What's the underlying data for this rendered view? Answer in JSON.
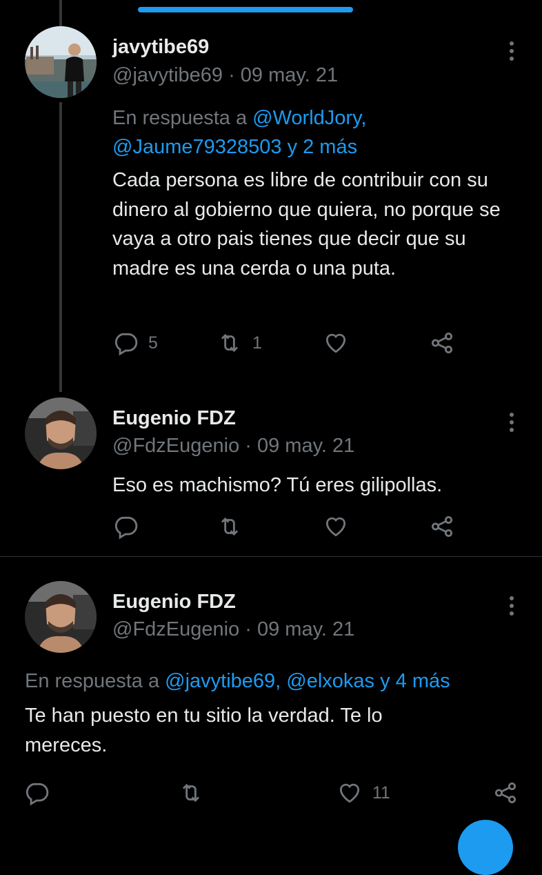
{
  "tweets": [
    {
      "name": "javytibe69",
      "handle_date": "@javytibe69 · 09 may. 21",
      "reply_prefix": "En respuesta a",
      "reply_mentions_1": "@WorldJory,",
      "reply_mentions_2": "@Jaume79328503 y 2 más",
      "text": "Cada persona es libre de contribuir con su dinero al gobierno que quiera, no porque se vaya a otro pais tienes que decir que su madre es una cerda o una puta.",
      "replies": "5",
      "retweets": "1",
      "likes": ""
    },
    {
      "name": "Eugenio FDZ",
      "handle_date": "@FdzEugenio · 09 may. 21",
      "text": "Eso es machismo? Tú eres gilipollas.",
      "replies": "",
      "retweets": "",
      "likes": ""
    },
    {
      "name": "Eugenio FDZ",
      "handle_date": "@FdzEugenio · 09 may. 21",
      "reply_prefix": "En respuesta a",
      "reply_mentions": "@javytibe69, @elxokas y 4 más",
      "text": "Te han puesto en tu sitio la verdad. Te lo mereces.",
      "replies": "",
      "retweets": "",
      "likes": "11"
    }
  ],
  "colors": {
    "accent": "#1d9bf0",
    "muted": "#71767b",
    "text": "#e7e9ea",
    "background": "#000000"
  },
  "icons": [
    "reply-icon",
    "retweet-icon",
    "like-icon",
    "share-icon",
    "more-options-icon"
  ]
}
